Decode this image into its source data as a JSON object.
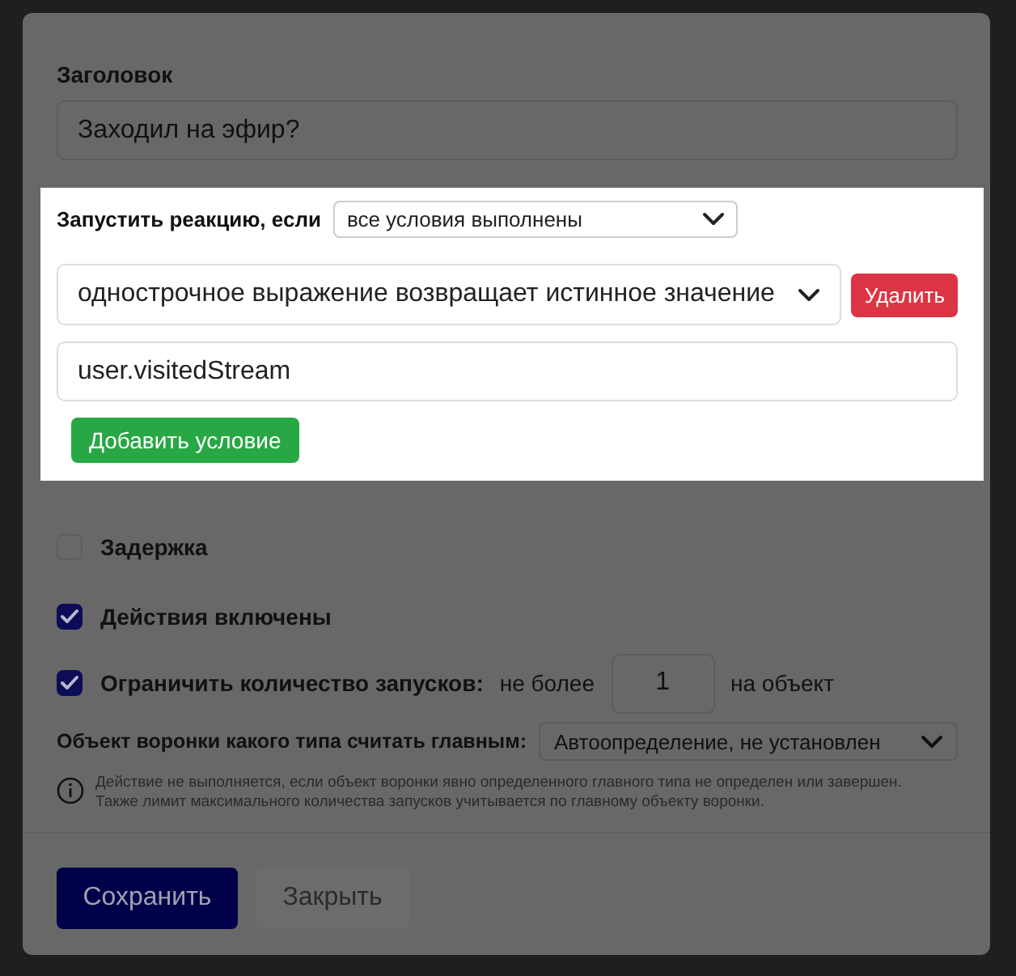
{
  "title_field": {
    "label": "Заголовок",
    "value": "Заходил на эфир?"
  },
  "conditions": {
    "label": "Запустить реакцию, если",
    "mode": "все условия выполнены",
    "items": [
      {
        "type": "однострочное выражение возвращает истинное значение",
        "delete_label": "Удалить",
        "expression": "user.visitedStream"
      }
    ],
    "add_label": "Добавить условие"
  },
  "options": [
    {
      "kind": "checkbox",
      "label": "Задержка",
      "checked": false
    },
    {
      "kind": "checkbox",
      "label": "Действия включены",
      "checked": true
    },
    {
      "kind": "limit",
      "label": "Ограничить количество запусков:",
      "checked": true,
      "prefix": "не более",
      "value": "1",
      "suffix": "на объект"
    }
  ],
  "funnel": {
    "label": "Объект воронки какого типа считать главным:",
    "value": "Автоопределение, не установлен",
    "note": "Действие не выполняется, если объект воронки явно определенного главного типа не определен или завершен.\nТакже лимит максимального количества запусков учитывается по главному объекту воронки."
  },
  "buttons": [
    {
      "kind": "primary",
      "label": "Сохранить"
    },
    {
      "kind": "secondary",
      "label": "Закрыть"
    }
  ]
}
